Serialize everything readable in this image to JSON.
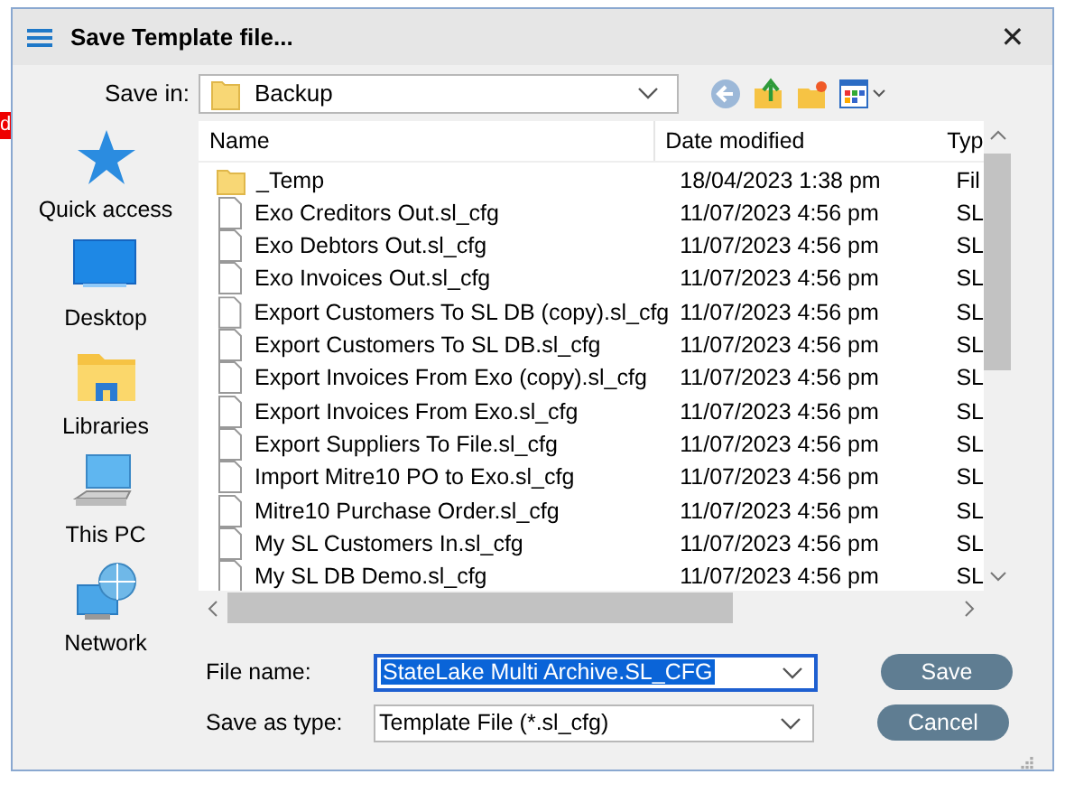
{
  "background_tag": "d",
  "window": {
    "title": "Save Template file...",
    "close": "✕"
  },
  "save_in": {
    "label": "Save in:",
    "value": "Backup"
  },
  "places": [
    {
      "label": "Quick access",
      "kind": "star"
    },
    {
      "label": "Desktop",
      "kind": "desktop"
    },
    {
      "label": "Libraries",
      "kind": "libraries"
    },
    {
      "label": "This PC",
      "kind": "pc"
    },
    {
      "label": "Network",
      "kind": "network"
    }
  ],
  "table": {
    "columns": [
      "Name",
      "Date modified",
      "Typ"
    ],
    "rows": [
      {
        "name": "_Temp",
        "date": "18/04/2023 1:38 pm",
        "type": "Fil",
        "kind": "folder"
      },
      {
        "name": "Exo Creditors Out.sl_cfg",
        "date": "11/07/2023 4:56 pm",
        "type": "SL",
        "kind": "file"
      },
      {
        "name": "Exo Debtors Out.sl_cfg",
        "date": "11/07/2023 4:56 pm",
        "type": "SL",
        "kind": "file"
      },
      {
        "name": "Exo Invoices Out.sl_cfg",
        "date": "11/07/2023 4:56 pm",
        "type": "SL",
        "kind": "file"
      },
      {
        "name": "Export Customers To SL DB (copy).sl_cfg",
        "date": "11/07/2023 4:56 pm",
        "type": "SL",
        "kind": "file"
      },
      {
        "name": "Export Customers To SL DB.sl_cfg",
        "date": "11/07/2023 4:56 pm",
        "type": "SL",
        "kind": "file"
      },
      {
        "name": "Export Invoices From Exo (copy).sl_cfg",
        "date": "11/07/2023 4:56 pm",
        "type": "SL",
        "kind": "file"
      },
      {
        "name": "Export Invoices From Exo.sl_cfg",
        "date": "11/07/2023 4:56 pm",
        "type": "SL",
        "kind": "file"
      },
      {
        "name": "Export Suppliers To File.sl_cfg",
        "date": "11/07/2023 4:56 pm",
        "type": "SL",
        "kind": "file"
      },
      {
        "name": "Import Mitre10 PO to Exo.sl_cfg",
        "date": "11/07/2023 4:56 pm",
        "type": "SL",
        "kind": "file"
      },
      {
        "name": "Mitre10 Purchase Order.sl_cfg",
        "date": "11/07/2023 4:56 pm",
        "type": "SL",
        "kind": "file"
      },
      {
        "name": "My SL Customers In.sl_cfg",
        "date": "11/07/2023 4:56 pm",
        "type": "SL",
        "kind": "file"
      },
      {
        "name": "My SL DB Demo.sl_cfg",
        "date": "11/07/2023 4:56 pm",
        "type": "SL",
        "kind": "file"
      }
    ]
  },
  "file_name": {
    "label": "File name:",
    "value": "StateLake Multi Archive.SL_CFG"
  },
  "save_as_type": {
    "label": "Save as type:",
    "value": "Template File (*.sl_cfg)"
  },
  "buttons": [
    "Save",
    "Cancel"
  ]
}
